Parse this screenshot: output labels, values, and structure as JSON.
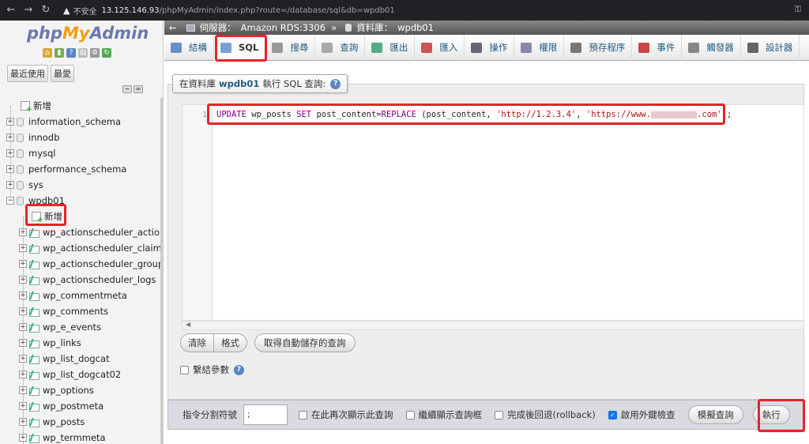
{
  "browser": {
    "insecure_label": "不安全",
    "url_host": "13.125.146.93",
    "url_path": "/phpMyAdmin/index.php?route=/database/sql&db=wpdb01"
  },
  "sidebar": {
    "logo_php": "php",
    "logo_my": "My",
    "logo_admin": "Admin",
    "tab_recent": "最近使用",
    "tab_favorites": "最愛",
    "new_label": "新增",
    "databases": [
      "information_schema",
      "innodb",
      "mysql",
      "performance_schema",
      "sys",
      "wpdb01"
    ],
    "wpdb01_new": "新增",
    "tables": [
      "wp_actionscheduler_actions",
      "wp_actionscheduler_claims",
      "wp_actionscheduler_groups",
      "wp_actionscheduler_logs",
      "wp_commentmeta",
      "wp_comments",
      "wp_e_events",
      "wp_links",
      "wp_list_dogcat",
      "wp_list_dogcat02",
      "wp_options",
      "wp_postmeta",
      "wp_posts",
      "wp_termmeta"
    ]
  },
  "breadcrumb": {
    "server_label": "伺服器：",
    "server_value": "Amazon RDS:3306",
    "separator": "»",
    "db_label": "資料庫：",
    "db_value": "wpdb01"
  },
  "tabs": [
    {
      "label": "結構",
      "icon": "structure-icon",
      "color": "#6a8fc5"
    },
    {
      "label": "SQL",
      "icon": "sql-icon",
      "color": "#7a9fd0"
    },
    {
      "label": "搜尋",
      "icon": "search-icon",
      "color": "#999"
    },
    {
      "label": "查詢",
      "icon": "query-icon",
      "color": "#aaa"
    },
    {
      "label": "匯出",
      "icon": "export-icon",
      "color": "#5a8"
    },
    {
      "label": "匯入",
      "icon": "import-icon",
      "color": "#c55"
    },
    {
      "label": "操作",
      "icon": "wrench-icon",
      "color": "#667"
    },
    {
      "label": "權限",
      "icon": "privileges-icon",
      "color": "#88a"
    },
    {
      "label": "預存程序",
      "icon": "routines-icon",
      "color": "#777"
    },
    {
      "label": "事件",
      "icon": "clock-icon",
      "color": "#c44"
    },
    {
      "label": "觸發器",
      "icon": "triggers-icon",
      "color": "#888"
    },
    {
      "label": "設計器",
      "icon": "designer-icon",
      "color": "#666"
    }
  ],
  "query_panel": {
    "legend_prefix": "在資料庫",
    "legend_db": "wpdb01",
    "legend_suffix": "執行 SQL 查詢:",
    "line_number": "1",
    "sql": {
      "kw_update": "UPDATE",
      "table": " wp_posts ",
      "kw_set": "SET",
      "col": " post_content=",
      "fn_replace": "REPLACE",
      "args_open": " (post_content, ",
      "str_from": "'http://1.2.3.4'",
      "comma": ", ",
      "str_to_prefix": "'https://www.",
      "str_to_suffix": ".com'",
      "close": ");"
    },
    "btn_clear": "清除",
    "btn_format": "格式",
    "btn_autosave": "取得自動儲存的查詢",
    "bind_params_label": "繫結參數"
  },
  "bottom_bar": {
    "delimiter_label": "指令分割符號",
    "delimiter_value": ";",
    "opt_retain_query": "在此再次顯示此查詢",
    "opt_retain_box": "繼續顯示查詢框",
    "opt_rollback": "完成後回退(rollback)",
    "opt_fk_checks": "啟用外鍵檢查",
    "fk_checked": true,
    "btn_simulate": "模擬查詢",
    "btn_go": "執行"
  },
  "highlight_color": "#e5242a"
}
